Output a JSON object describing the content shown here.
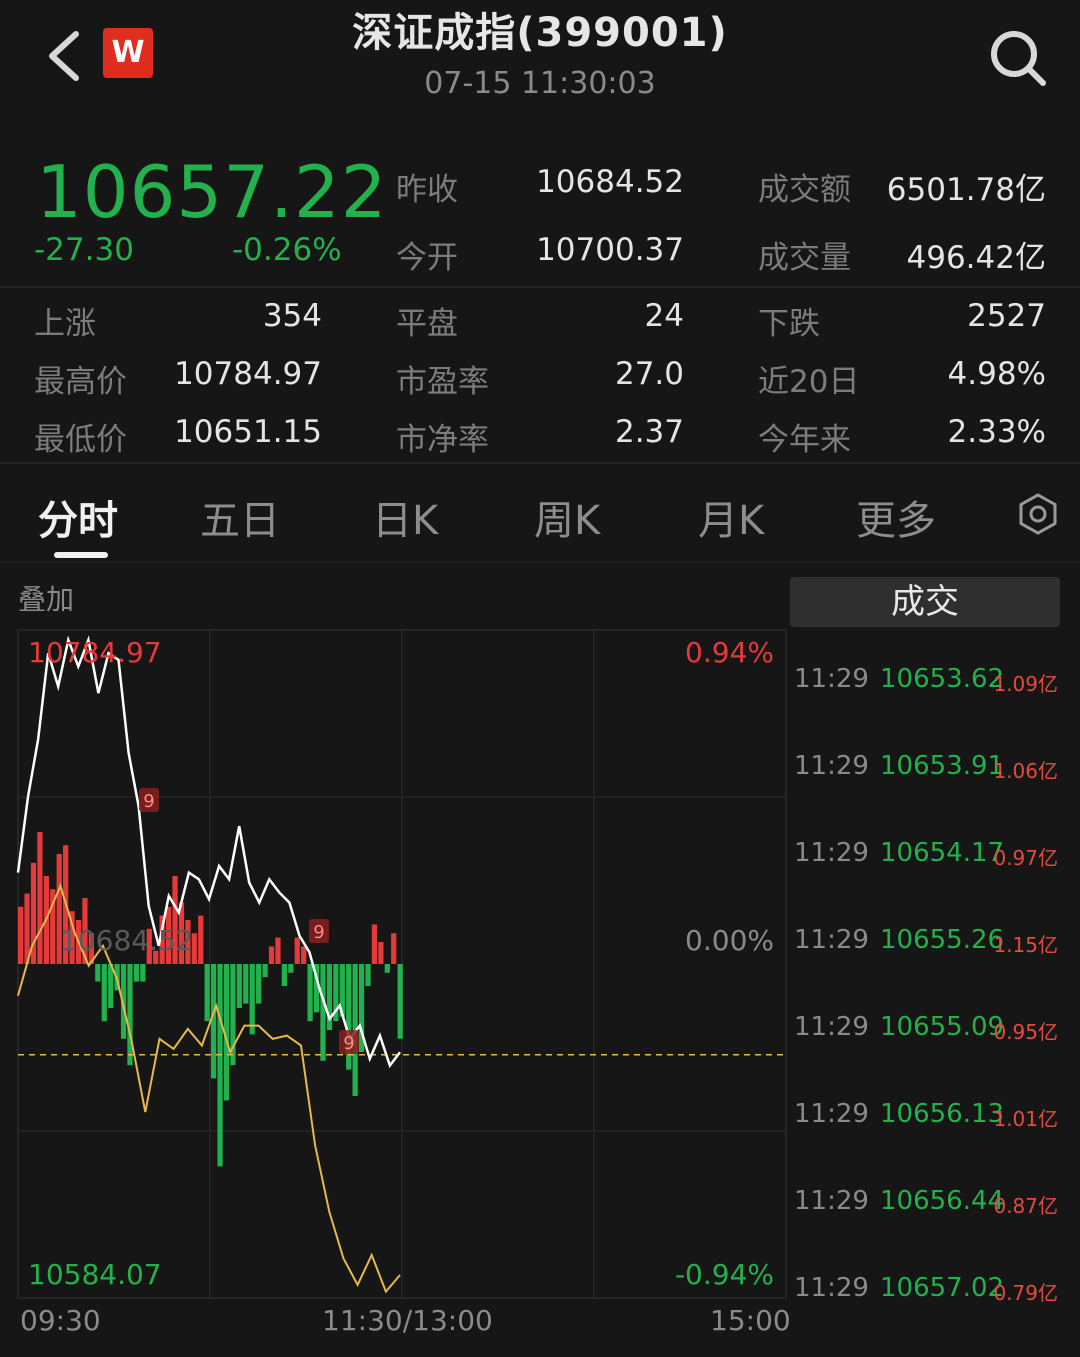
{
  "header": {
    "title": "深证成指(399001)",
    "datetime": "07-15 11:30:03",
    "logo_text": "W"
  },
  "quote": {
    "price": "10657.22",
    "change": "-27.30",
    "change_pct": "-0.26%",
    "price_color": "#22b14c",
    "fields": [
      {
        "label": "昨收",
        "value": "10684.52"
      },
      {
        "label": "成交额",
        "value": "6501.78亿"
      },
      {
        "label": "今开",
        "value": "10700.37"
      },
      {
        "label": "成交量",
        "value": "496.42亿"
      }
    ]
  },
  "stats": [
    {
      "label": "上涨",
      "value": "354"
    },
    {
      "label": "平盘",
      "value": "24"
    },
    {
      "label": "下跌",
      "value": "2527"
    },
    {
      "label": "最高价",
      "value": "10784.97"
    },
    {
      "label": "市盈率",
      "value": "27.0"
    },
    {
      "label": "近20日",
      "value": "4.98%"
    },
    {
      "label": "最低价",
      "value": "10651.15"
    },
    {
      "label": "市净率",
      "value": "2.37"
    },
    {
      "label": "今年来",
      "value": "2.33%"
    }
  ],
  "tabs": [
    {
      "label": "分时",
      "active": true
    },
    {
      "label": "五日"
    },
    {
      "label": "日K"
    },
    {
      "label": "周K"
    },
    {
      "label": "月K"
    },
    {
      "label": "更多"
    }
  ],
  "overlay_label": "叠加",
  "chart_data": {
    "type": "line",
    "high_label": "10784.97",
    "low_label": "10584.07",
    "prev_close_label": "10684.52",
    "pct_top": "0.94%",
    "pct_mid": "0.00%",
    "pct_bottom": "-0.94%",
    "time_labels": [
      "09:30",
      "11:30/13:00",
      "15:00"
    ],
    "ylim": [
      10584.07,
      10784.97
    ],
    "prev_close": 10684.52,
    "current": 10657.22,
    "marker_labels": [
      "9",
      "9",
      "9"
    ],
    "series": [
      {
        "values": [
          10712,
          10735,
          10752,
          10778,
          10768,
          10782,
          10774,
          10782,
          10766,
          10778,
          10776,
          10748,
          10732,
          10702,
          10690,
          10705,
          10700,
          10712,
          10710,
          10704,
          10714,
          10710,
          10726,
          10709,
          10703,
          10710,
          10706,
          10703,
          10693,
          10688,
          10677,
          10668,
          10672,
          10662,
          10666,
          10656,
          10663,
          10654,
          10658
        ],
        "color": "#ffffff"
      },
      {
        "values": [
          10675,
          10690,
          10698,
          10708,
          10694,
          10684,
          10690,
          10680,
          10662,
          10640,
          10662,
          10659,
          10665,
          10660,
          10672,
          10658,
          10666,
          10666,
          10662,
          10663,
          10660,
          10630,
          10610,
          10596,
          10588,
          10597,
          10586,
          10591
        ],
        "color": "#e5b94a"
      }
    ],
    "volume_bars": [
      26,
      32,
      46,
      60,
      40,
      34,
      50,
      54,
      24,
      20,
      30,
      14,
      -8,
      -26,
      -20,
      -12,
      -34,
      -46,
      -8,
      -8,
      16,
      6,
      22,
      26,
      40,
      28,
      20,
      14,
      22,
      -26,
      -52,
      -92,
      -62,
      -46,
      -20,
      -18,
      -32,
      -18,
      -6,
      8,
      12,
      -10,
      -4,
      12,
      8,
      -26,
      -22,
      -44,
      -30,
      -26,
      -24,
      -48,
      -60,
      -40,
      -10,
      18,
      10,
      -4,
      14,
      -34
    ]
  },
  "trades": {
    "header": "成交",
    "rows": [
      {
        "time": "11:29",
        "price": "10653.62",
        "volume": "1.09亿"
      },
      {
        "time": "11:29",
        "price": "10653.91",
        "volume": "1.06亿"
      },
      {
        "time": "11:29",
        "price": "10654.17",
        "volume": "0.97亿"
      },
      {
        "time": "11:29",
        "price": "10655.26",
        "volume": "1.15亿"
      },
      {
        "time": "11:29",
        "price": "10655.09",
        "volume": "0.95亿"
      },
      {
        "time": "11:29",
        "price": "10656.13",
        "volume": "1.01亿"
      },
      {
        "time": "11:29",
        "price": "10656.44",
        "volume": "0.87亿"
      },
      {
        "time": "11:29",
        "price": "10657.02",
        "volume": "0.79亿"
      }
    ]
  },
  "colors": {
    "up": "#e5393a",
    "down": "#22b14c",
    "avg_line": "#e5b94a"
  }
}
